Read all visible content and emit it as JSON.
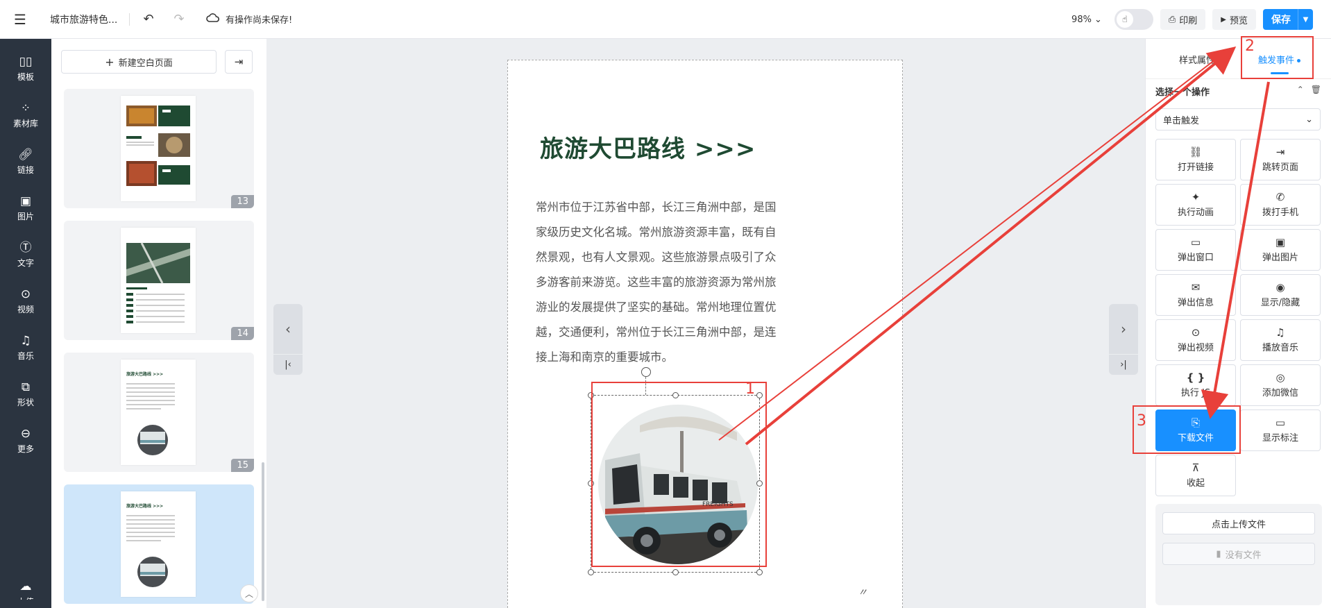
{
  "topbar": {
    "doc_title": "城市旅游特色...",
    "save_status": "有操作尚未保存!",
    "zoom": "98%",
    "print_label": "印刷",
    "preview_label": "预览",
    "save_label": "保存"
  },
  "leftnav": {
    "items": [
      {
        "label": "模板",
        "icon": "template-icon"
      },
      {
        "label": "素材库",
        "icon": "material-icon"
      },
      {
        "label": "链接",
        "icon": "link-icon"
      },
      {
        "label": "图片",
        "icon": "image-icon"
      },
      {
        "label": "文字",
        "icon": "text-icon"
      },
      {
        "label": "视频",
        "icon": "video-icon"
      },
      {
        "label": "音乐",
        "icon": "music-icon"
      },
      {
        "label": "形状",
        "icon": "shape-icon"
      },
      {
        "label": "更多",
        "icon": "more-icon"
      },
      {
        "label": "上传",
        "icon": "upload-icon"
      }
    ]
  },
  "pagelist": {
    "new_page_label": "新建空白页面",
    "pages": [
      {
        "num": "13"
      },
      {
        "num": "14"
      },
      {
        "num": "15",
        "title": "旅游大巴路线 >>>"
      },
      {
        "num": "16",
        "title": "旅游大巴路线 >>>"
      }
    ]
  },
  "page": {
    "title": "旅游大巴路线 >>>",
    "body": "常州市位于江苏省中部，长江三角洲中部，是国家级历史文化名城。常州旅游资源丰富，既有自然景观，也有人文景观。这些旅游景点吸引了众多游客前来游览。这些丰富的旅游资源为常州旅游业的发展提供了坚实的基础。常州地理位置优越，交通便利，常州位于长江三角洲中部，是连接上海和南京的重要城市。",
    "footer_mark": "〃",
    "bus_caption": "FREIGHTS"
  },
  "rightpanel": {
    "tab_style": "样式属性",
    "tab_event": "触发事件",
    "section_label": "选择一个操作",
    "trigger_select": "单击触发",
    "actions": [
      {
        "label": "打开链接",
        "icon": "link-icon"
      },
      {
        "label": "跳转页面",
        "icon": "jump-page-icon"
      },
      {
        "label": "执行动画",
        "icon": "sparkle-icon"
      },
      {
        "label": "拨打手机",
        "icon": "phone-icon"
      },
      {
        "label": "弹出窗口",
        "icon": "window-icon"
      },
      {
        "label": "弹出图片",
        "icon": "image-icon"
      },
      {
        "label": "弹出信息",
        "icon": "envelope-icon"
      },
      {
        "label": "显示/隐藏",
        "icon": "eye-icon"
      },
      {
        "label": "弹出视频",
        "icon": "video-icon"
      },
      {
        "label": "播放音乐",
        "icon": "music-icon"
      },
      {
        "label": "执行 JS",
        "icon": "braces-icon"
      },
      {
        "label": "添加微信",
        "icon": "wechat-icon"
      },
      {
        "label": "下载文件",
        "icon": "download-file-icon",
        "selected": true
      },
      {
        "label": "显示标注",
        "icon": "comment-icon"
      },
      {
        "label": "收起",
        "icon": "collapse-icon"
      }
    ],
    "upload_label": "点击上传文件",
    "no_file_label": "没有文件"
  },
  "annotations": {
    "labels": [
      "1",
      "2",
      "3"
    ],
    "color": "#e8403a"
  },
  "colors": {
    "accent": "#1890ff",
    "sidebar_bg": "#2b3440",
    "title_green": "#1f4a32"
  }
}
